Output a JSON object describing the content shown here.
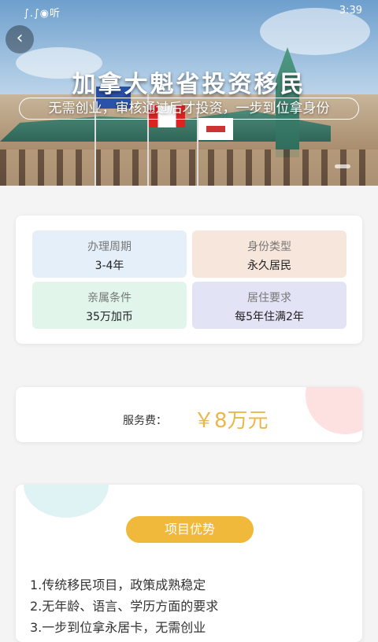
{
  "status_bar": {
    "left": "∫.∫◉听",
    "time": "3:39"
  },
  "nav": {
    "back_icon": "‹"
  },
  "hero": {
    "title": "加拿大魁省投资移民",
    "subtitle": "无需创业，审核通过后才投资，一步到位拿身份"
  },
  "info_tiles": [
    {
      "label": "办理周期",
      "value": "3-4年",
      "color": "#e5effa"
    },
    {
      "label": "身份类型",
      "value": "永久居民",
      "color": "#f7e6dc"
    },
    {
      "label": "亲属条件",
      "value": "35万加币",
      "color": "#e1f5ea"
    },
    {
      "label": "居住要求",
      "value": "每5年住满2年",
      "color": "#e2e4f6"
    }
  ],
  "fee": {
    "label": "服务费：",
    "value": "￥8万元"
  },
  "advantages": {
    "button_label": "项目优势",
    "items": [
      "1.传统移民项目，政策成熟稳定",
      "2.无年龄、语言、学历方面的要求",
      "3.一步到位拿永居卡，无需创业"
    ]
  },
  "colors": {
    "accent": "#f0b93c",
    "fee": "#e8b84a"
  }
}
